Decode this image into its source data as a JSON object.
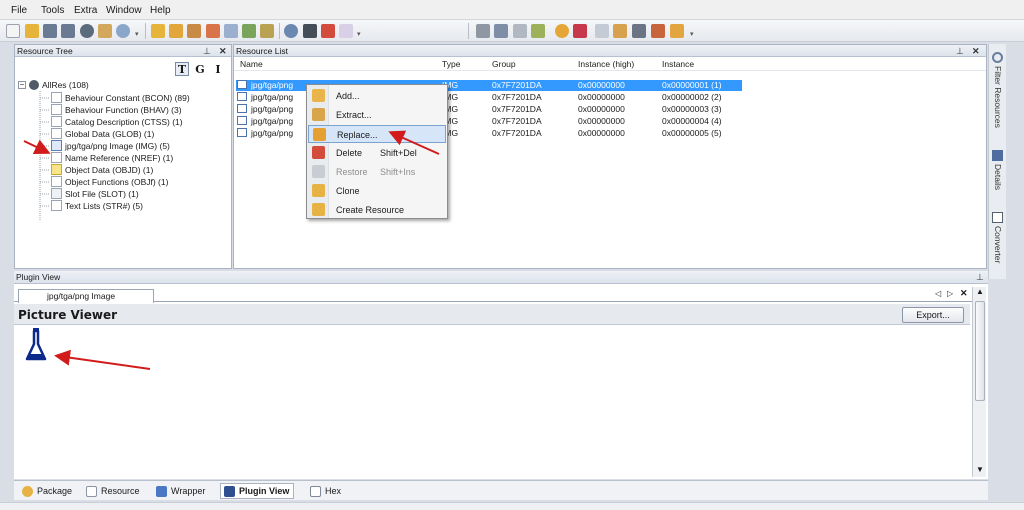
{
  "menu": [
    "File",
    "Tools",
    "Extra",
    "Window",
    "Help"
  ],
  "toolbar": {
    "icons": [
      "new-icon",
      "open-icon",
      "save-icon",
      "save-as-icon",
      "close-icon",
      "users-icon",
      "search-icon",
      "folder-open-icon",
      "folder-save-icon",
      "book-icon",
      "cut-icon",
      "copy-icon",
      "paste-icon",
      "list-icon",
      "gear-icon",
      "clean-icon",
      "delete-icon",
      "erase-icon",
      "package-icon",
      "image-icon",
      "link-icon",
      "grid-icon",
      "gear2-icon",
      "bar-icon",
      "close2-icon",
      "wizard-icon",
      "picture-icon",
      "people-icon",
      "person-icon"
    ]
  },
  "resource_tree": {
    "title": "Resource Tree",
    "mode_buttons": [
      "T",
      "G",
      "I"
    ],
    "root": "AllRes (108)",
    "items": [
      "Behaviour Constant (BCON) (89)",
      "Behaviour Function (BHAV) (3)",
      "Catalog Description (CTSS) (1)",
      "Global Data (GLOB) (1)",
      "jpg/tga/png Image (IMG) (5)",
      "Name Reference (NREF) (1)",
      "Object Data (OBJD) (1)",
      "Object Functions (OBJf) (1)",
      "Slot File (SLOT) (1)",
      "Text Lists (STR#) (5)"
    ]
  },
  "resource_list": {
    "title": "Resource List",
    "columns": [
      "Name",
      "Type",
      "Group",
      "Instance (high)",
      "Instance"
    ],
    "rows": [
      {
        "name": "jpg/tga/png",
        "type": "IMG",
        "group": "0x7F7201DA",
        "inst_high": "0x00000000",
        "inst": "0x00000001 (1)"
      },
      {
        "name": "jpg/tga/png",
        "type": "IMG",
        "group": "0x7F7201DA",
        "inst_high": "0x00000000",
        "inst": "0x00000002 (2)"
      },
      {
        "name": "jpg/tga/png",
        "type": "IMG",
        "group": "0x7F7201DA",
        "inst_high": "0x00000000",
        "inst": "0x00000003 (3)"
      },
      {
        "name": "jpg/tga/png",
        "type": "IMG",
        "group": "0x7F7201DA",
        "inst_high": "0x00000000",
        "inst": "0x00000004 (4)"
      },
      {
        "name": "jpg/tga/png",
        "type": "IMG",
        "group": "0x7F7201DA",
        "inst_high": "0x00000000",
        "inst": "0x00000005 (5)"
      }
    ]
  },
  "context_menu": {
    "items": [
      {
        "label": "Add...",
        "shortcut": ""
      },
      {
        "label": "Extract...",
        "shortcut": ""
      },
      {
        "label": "Replace...",
        "shortcut": ""
      },
      {
        "label": "Delete",
        "shortcut": "Shift+Del"
      },
      {
        "label": "Restore",
        "shortcut": "Shift+Ins"
      },
      {
        "label": "Clone",
        "shortcut": ""
      },
      {
        "label": "Create Resource",
        "shortcut": ""
      }
    ]
  },
  "plugin_view": {
    "title": "Plugin View",
    "tab": "jpg/tga/png Image",
    "header": "Picture Viewer",
    "export": "Export..."
  },
  "bottom_tabs": [
    "Package",
    "Resource",
    "Wrapper",
    "Plugin View",
    "Hex"
  ],
  "side_tabs": [
    "Filter Resources",
    "Details",
    "Converter"
  ],
  "colors": {
    "selection": "#3399ff",
    "annotation_arrow": "#d21b1b",
    "flask": "#0b2a8c"
  }
}
